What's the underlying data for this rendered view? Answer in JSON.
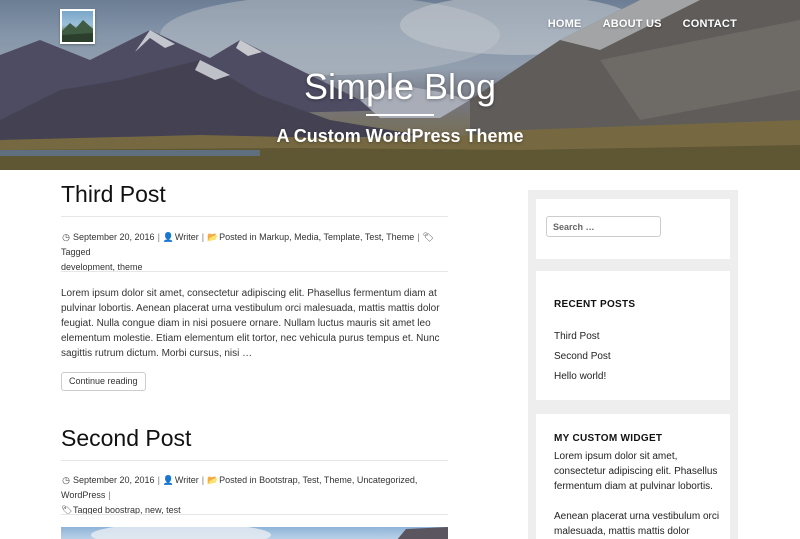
{
  "header": {
    "site_title": "Simple Blog",
    "site_description": "A Custom WordPress Theme",
    "nav": [
      "HOME",
      "ABOUT US",
      "CONTACT"
    ]
  },
  "posts": [
    {
      "title": "Third Post",
      "date": "September 20, 2016",
      "author": "Writer",
      "categories_label": "Posted in Markup, Media, Template, Test, Theme",
      "tags_label": "Tagged",
      "tags_line2": "development, theme",
      "excerpt": "Lorem ipsum dolor sit amet, consectetur adipiscing elit. Phasellus fermentum diam at pulvinar lobortis. Aenean placerat urna vestibulum orci malesuada, mattis mattis dolor feugiat. Nulla congue diam in nisi posuere ornare. Nullam luctus mauris sit amet leo elementum molestie. Etiam elementum elit tortor, nec vehicula purus tempus et. Nunc sagittis rutrum dictum. Morbi cursus, nisi …",
      "button": "Continue reading"
    },
    {
      "title": "Second Post",
      "date": "September 20, 2016",
      "author": "Writer",
      "categories_label": "Posted in Bootstrap, Test, Theme, Uncategorized, WordPress",
      "tags_label": "Tagged boostrap, new, test"
    }
  ],
  "sidebar": {
    "search_placeholder": "Search …",
    "recent_title": "RECENT POSTS",
    "recent_items": [
      "Third Post",
      "Second Post",
      "Hello world!"
    ],
    "custom_title": "MY CUSTOM WIDGET",
    "custom_p1": "Lorem ipsum dolor sit amet, consectetur adipiscing elit. Phasellus fermentum diam at pulvinar lobortis.",
    "custom_p2": "Aenean placerat urna vestibulum orci malesuada, mattis mattis dolor feugiat."
  },
  "icons": {
    "date": "clock-icon",
    "author": "user-icon",
    "category": "folder-open-icon",
    "tags": "tags-icon"
  }
}
